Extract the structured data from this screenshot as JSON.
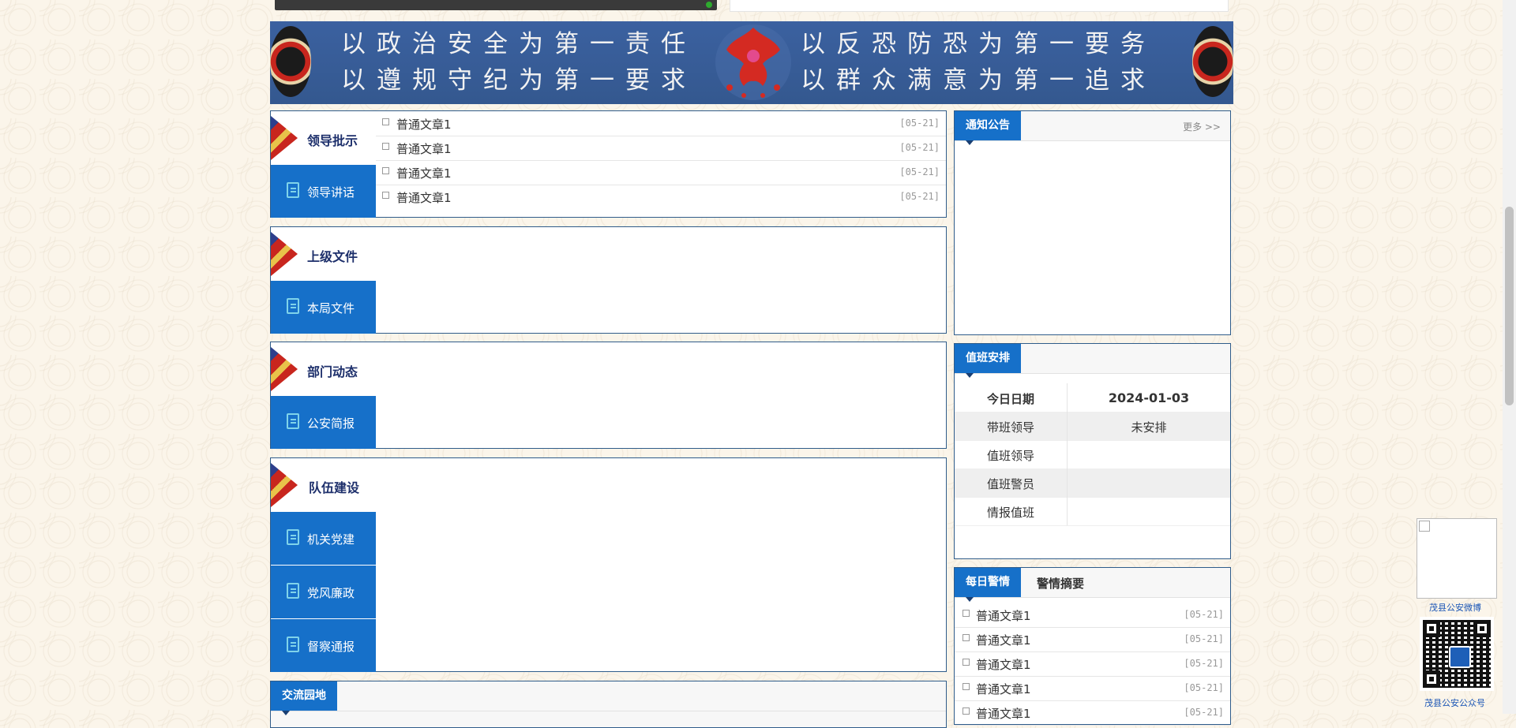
{
  "banner": {
    "line1_left": "以政治安全为第一责任",
    "line1_right": "以反恐防恐为第一要务",
    "line2_left": "以遵规守纪为第一要求",
    "line2_right": "以群众满意为第一追求"
  },
  "panels": {
    "leader": {
      "tab_active": "领导批示",
      "tab_second": "领导讲话",
      "articles": [
        {
          "title": "普通文章1",
          "date": "[05-21]"
        },
        {
          "title": "普通文章1",
          "date": "[05-21]"
        },
        {
          "title": "普通文章1",
          "date": "[05-21]"
        },
        {
          "title": "普通文章1",
          "date": "[05-21]"
        }
      ]
    },
    "documents": {
      "tab_active": "上级文件",
      "tab_second": "本局文件"
    },
    "department": {
      "tab_active": "部门动态",
      "tab_second": "公安简报"
    },
    "team": {
      "tab_active": "队伍建设",
      "tabs": [
        "机关党建",
        "党风廉政",
        "督察通报"
      ]
    },
    "exchange": {
      "tab_active": "交流园地"
    }
  },
  "notice": {
    "title": "通知公告",
    "more": "更多 >>"
  },
  "duty": {
    "title": "值班安排",
    "rows": [
      {
        "label": "今日日期",
        "value": "2024-01-03"
      },
      {
        "label": "带班领导",
        "value": "未安排"
      },
      {
        "label": "值班领导",
        "value": ""
      },
      {
        "label": "值班警员",
        "value": ""
      },
      {
        "label": "情报值班",
        "value": ""
      }
    ]
  },
  "daily": {
    "tab_active": "每日警情",
    "tab_second": "警情摘要",
    "articles": [
      {
        "title": "普通文章1",
        "date": "[05-21]"
      },
      {
        "title": "普通文章1",
        "date": "[05-21]"
      },
      {
        "title": "普通文章1",
        "date": "[05-21]"
      },
      {
        "title": "普通文章1",
        "date": "[05-21]"
      },
      {
        "title": "普通文章1",
        "date": "[05-21]"
      }
    ]
  },
  "float": {
    "weibo_label": "茂县公安微博",
    "wechat_label": "茂县公安公众号"
  },
  "colors": {
    "accent_blue": "#1670c9",
    "border_blue": "#2f5c8a",
    "banner_blue": "#3b61a0"
  }
}
